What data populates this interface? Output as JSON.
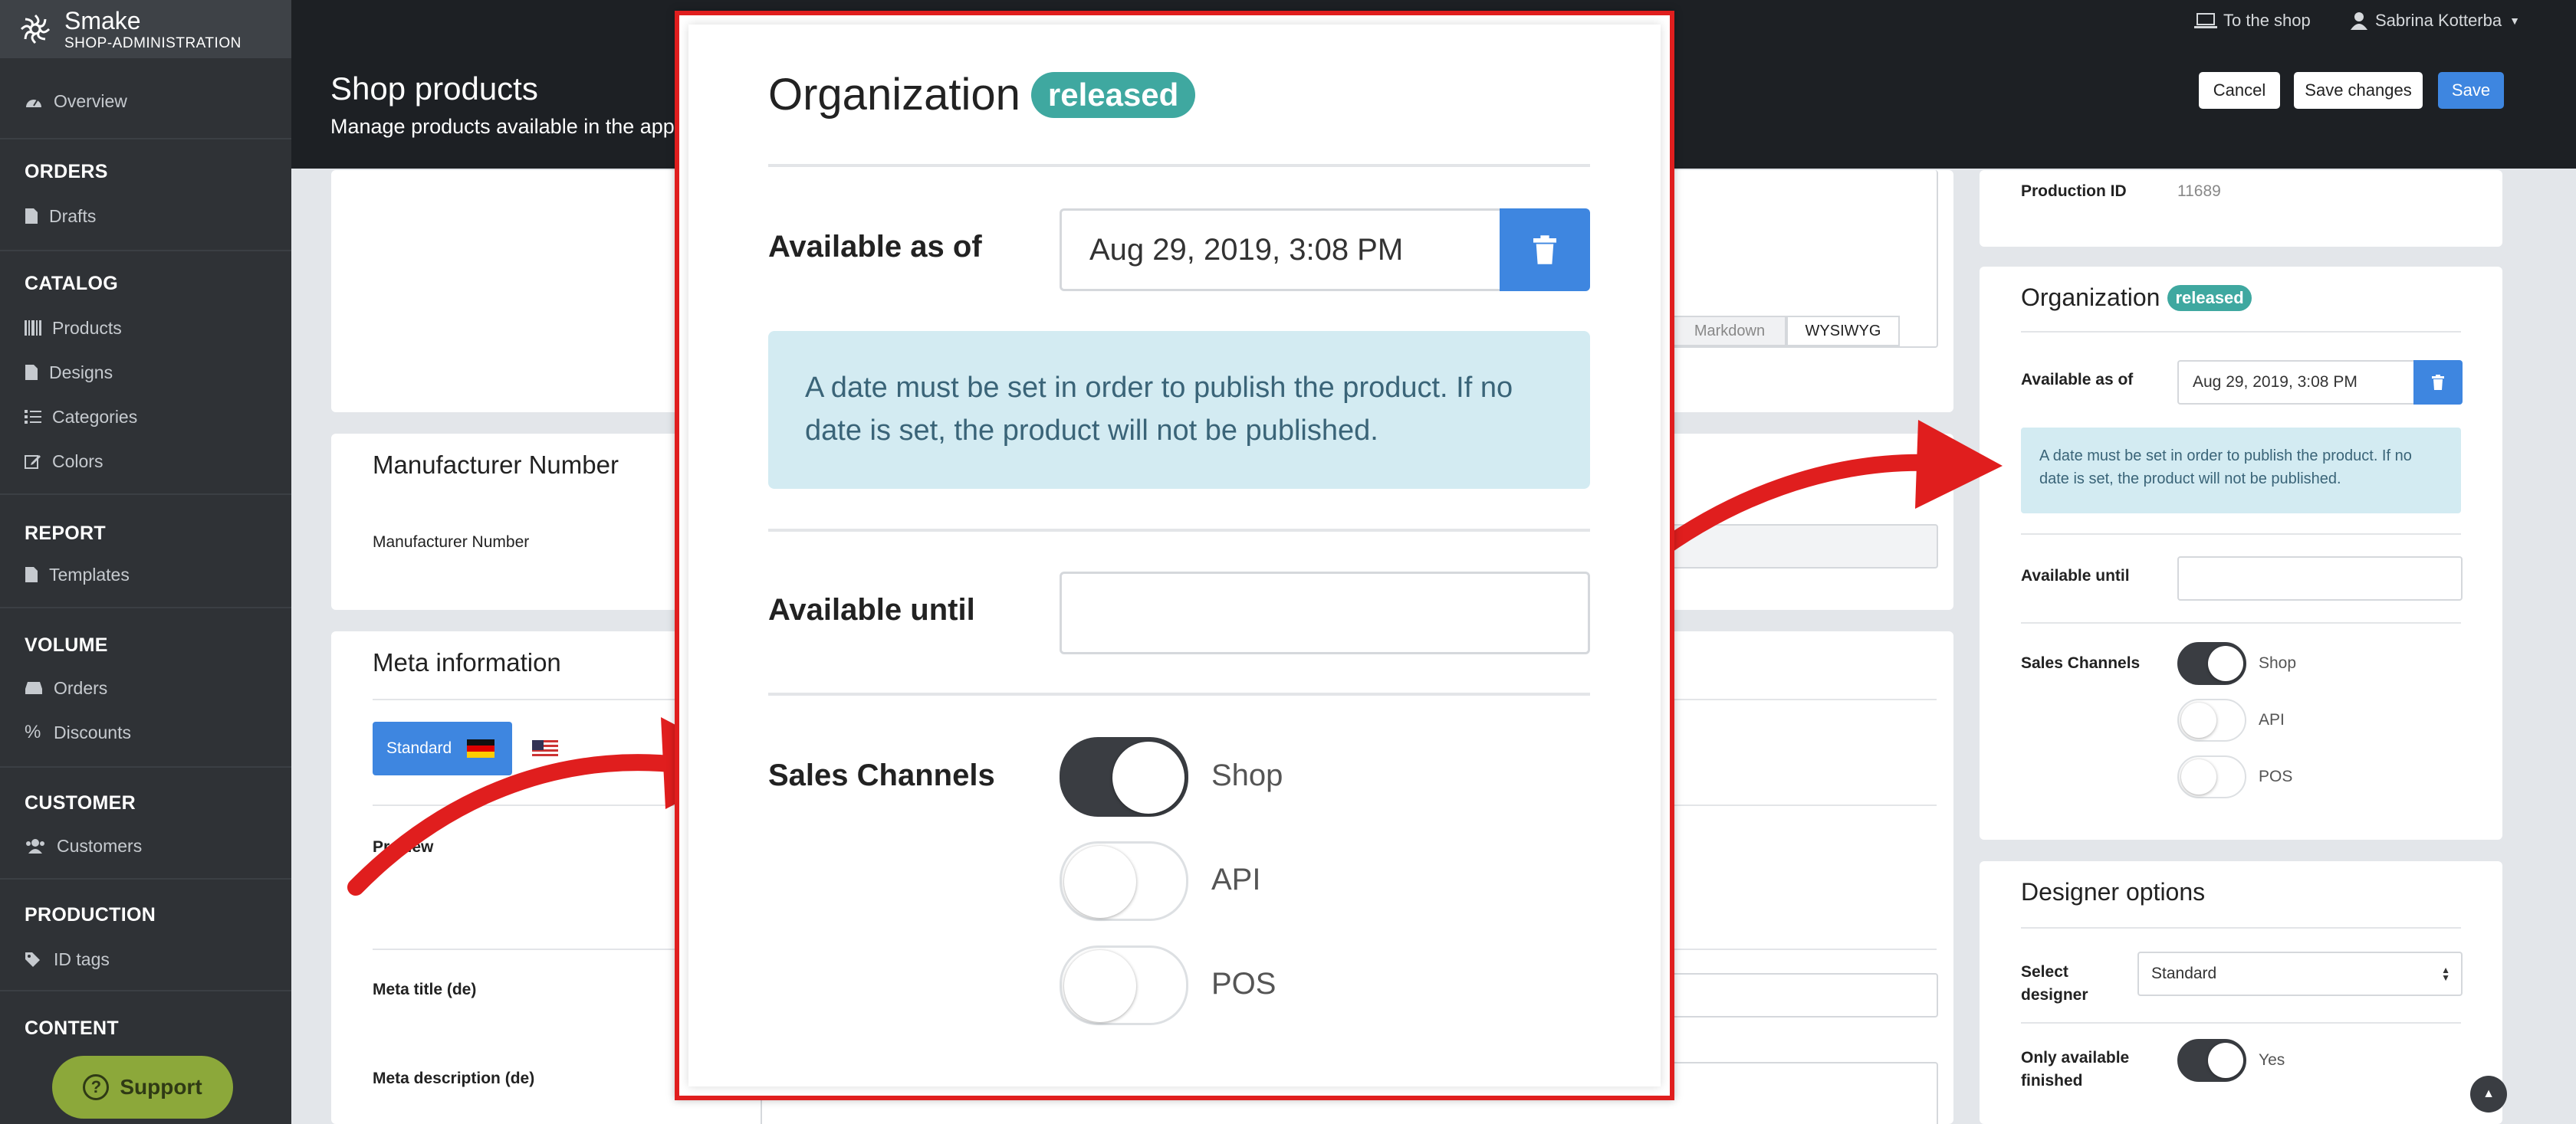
{
  "app": {
    "name": "Smake",
    "subtitle": "SHOP-ADMINISTRATION"
  },
  "sidebar": {
    "overview": "Overview",
    "sections": [
      {
        "title": "ORDERS",
        "items": [
          "Drafts"
        ]
      },
      {
        "title": "CATALOG",
        "items": [
          "Products",
          "Designs",
          "Categories",
          "Colors"
        ]
      },
      {
        "title": "REPORT",
        "items": [
          "Templates"
        ]
      },
      {
        "title": "VOLUME",
        "items": [
          "Orders",
          "Discounts"
        ]
      },
      {
        "title": "CUSTOMER",
        "items": [
          "Customers"
        ]
      },
      {
        "title": "PRODUCTION",
        "items": [
          "ID tags"
        ]
      },
      {
        "title": "CONTENT",
        "items": []
      }
    ],
    "support": "Support"
  },
  "header": {
    "title": "Shop products",
    "subtitle": "Manage products available in the app",
    "to_shop": "To the shop",
    "user": "Sabrina Kotterba",
    "cancel": "Cancel",
    "save_changes": "Save changes",
    "save": "Save"
  },
  "editor": {
    "markdown": "Markdown",
    "wysiwyg": "WYSIWYG"
  },
  "manufacturer": {
    "title": "Manufacturer Number",
    "label": "Manufacturer Number"
  },
  "meta": {
    "title": "Meta information",
    "lang_tab": "Standard",
    "preview": "Preview",
    "meta_title": "Meta title (de)",
    "meta_desc": "Meta description (de)"
  },
  "production": {
    "label": "Production ID",
    "value": "11689"
  },
  "organization": {
    "title": "Organization",
    "badge": "released",
    "available_label": "Available as of",
    "available_value": "Aug 29, 2019, 3:08 PM",
    "info": "A date must be set in order to publish the product. If no date is set, the product will not be published.",
    "until_label": "Available until",
    "until_value": "",
    "channels_label": "Sales Channels",
    "channels": [
      {
        "name": "Shop",
        "on": true
      },
      {
        "name": "API",
        "on": false
      },
      {
        "name": "POS",
        "on": false
      }
    ]
  },
  "designer": {
    "title": "Designer options",
    "select_label": "Select designer",
    "select_value": "Standard",
    "only_label": "Only available finished",
    "only_value": "Yes"
  },
  "colors": {
    "accent": "#3e86e0",
    "badge": "#3fa8a0",
    "info_bg": "#d3ebf2",
    "arrow": "#e01e1e",
    "support": "#8ca83a"
  }
}
